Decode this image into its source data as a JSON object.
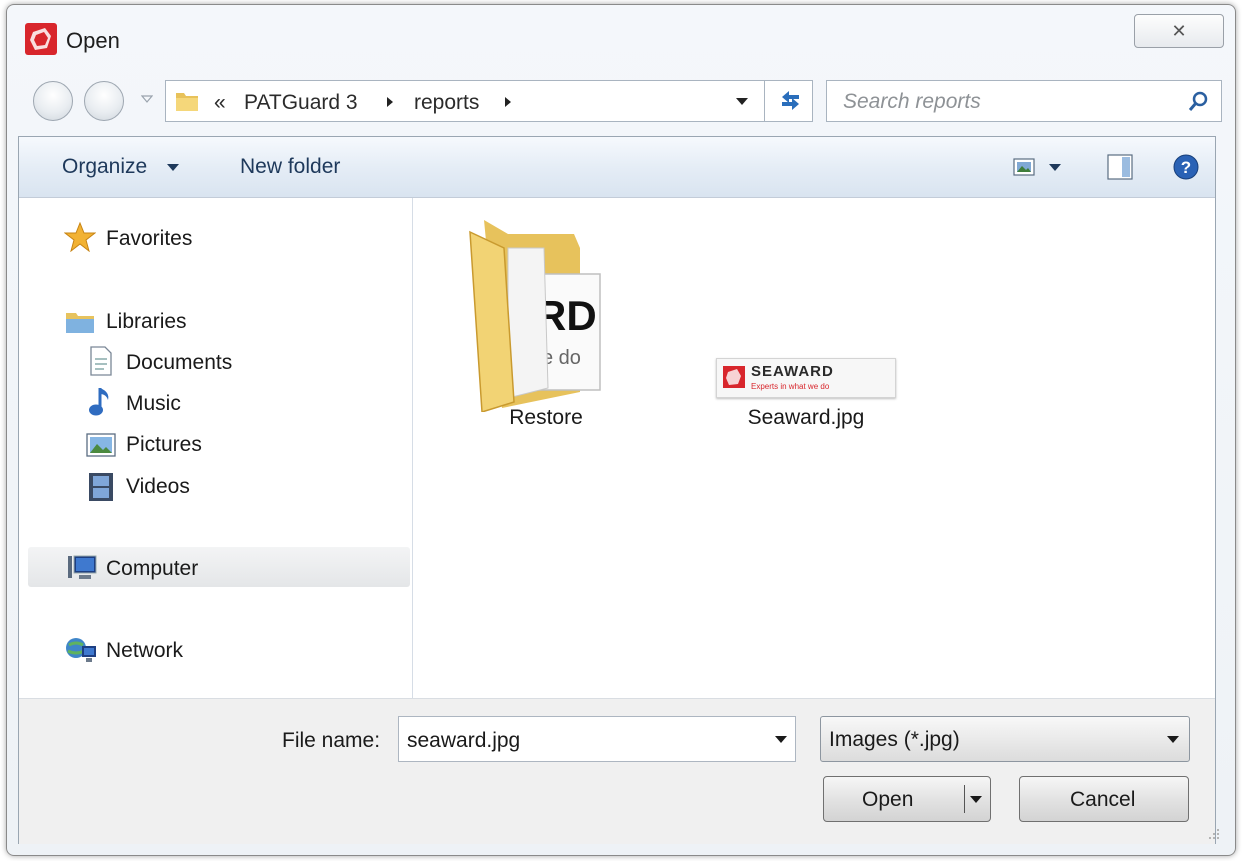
{
  "window": {
    "title": "Open",
    "close_glyph": "✕"
  },
  "address_bar": {
    "overflow": "«",
    "crumbs": [
      "PATGuard 3",
      "reports"
    ]
  },
  "search": {
    "placeholder": "Search reports"
  },
  "toolbar": {
    "organize_label": "Organize",
    "new_folder_label": "New folder"
  },
  "nav_pane": {
    "favorites": "Favorites",
    "libraries": "Libraries",
    "library_items": [
      "Documents",
      "Music",
      "Pictures",
      "Videos"
    ],
    "computer": "Computer",
    "network": "Network"
  },
  "files": [
    {
      "name": "Restore",
      "type": "folder"
    },
    {
      "name": "Seaward.jpg",
      "type": "image"
    }
  ],
  "folder_preview": {
    "big_text": "RD",
    "small_text": "e do"
  },
  "seaward_logo": {
    "brand": "SEAWARD",
    "tagline": "Experts in what we do"
  },
  "bottom": {
    "file_name_label": "File name:",
    "file_name_value": "seaward.jpg",
    "filter_value": "Images (*.jpg)",
    "open_label": "Open",
    "cancel_label": "Cancel"
  },
  "colors": {
    "toolbar_text": "#1e395b",
    "accent_blue": "#2a6ebb",
    "seaward_red": "#d8262c"
  }
}
